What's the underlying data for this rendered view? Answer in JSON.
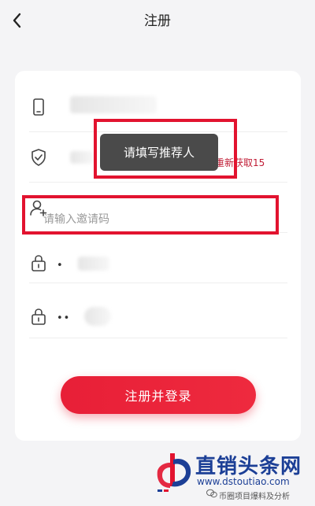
{
  "header": {
    "title": "注册"
  },
  "form": {
    "resend_label": "重新获取15",
    "invite_placeholder": "请输入邀请码",
    "password_mask": "•",
    "confirm_mask": "••"
  },
  "toast": {
    "text": "请填写推荐人"
  },
  "submit": {
    "label": "注册并登录"
  },
  "colors": {
    "accent": "#e81f37",
    "annotation": "#e2132f",
    "brand_blue": "#1c3f96"
  },
  "icons": [
    "back-chevron-icon",
    "phone-icon",
    "shield-check-icon",
    "user-add-icon",
    "lock-icon"
  ],
  "watermark": {
    "name": "直销头条网",
    "url": "www.dstoutiao.com",
    "sub": "币圈项目爆料及分析"
  }
}
